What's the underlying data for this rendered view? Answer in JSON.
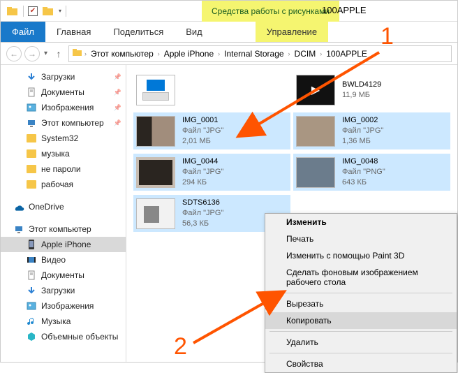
{
  "annotations": {
    "num1": "1",
    "num2": "2"
  },
  "titlebar": {
    "context_tab": "Средства работы с рисунками",
    "title": "100APPLE"
  },
  "ribbon": {
    "file": "Файл",
    "tabs": [
      "Главная",
      "Поделиться",
      "Вид"
    ],
    "context": "Управление"
  },
  "address": {
    "crumbs": [
      "Этот компьютер",
      "Apple iPhone",
      "Internal Storage",
      "DCIM",
      "100APPLE"
    ]
  },
  "sidebar": {
    "quick": [
      {
        "label": "Загрузки",
        "icon": "down-arrow",
        "pinned": true
      },
      {
        "label": "Документы",
        "icon": "doc",
        "pinned": true
      },
      {
        "label": "Изображения",
        "icon": "pic",
        "pinned": true
      },
      {
        "label": "Этот компьютер",
        "icon": "pc",
        "pinned": true
      },
      {
        "label": "System32",
        "icon": "folder"
      },
      {
        "label": "музыка",
        "icon": "folder"
      },
      {
        "label": "не пароли",
        "icon": "folder"
      },
      {
        "label": "рабочая",
        "icon": "folder"
      }
    ],
    "onedrive": "OneDrive",
    "thispc": "Этот компьютер",
    "devices": [
      {
        "label": "Apple iPhone",
        "selected": true,
        "icon": "phone"
      },
      {
        "label": "Видео",
        "icon": "video"
      },
      {
        "label": "Документы",
        "icon": "doc"
      },
      {
        "label": "Загрузки",
        "icon": "down-arrow"
      },
      {
        "label": "Изображения",
        "icon": "pic"
      },
      {
        "label": "Музыка",
        "icon": "music"
      },
      {
        "label": "Объемные объекты",
        "icon": "3d"
      }
    ]
  },
  "files": [
    {
      "name": "",
      "sub1": "",
      "sub2": "",
      "thumb": "drive",
      "sel": false
    },
    {
      "name": "BWLD4129",
      "sub1": "11,9 МБ",
      "sub2": "",
      "thumb": "video",
      "sel": false
    },
    {
      "name": "IMG_0001",
      "sub1": "Файл \"JPG\"",
      "sub2": "2,01 МБ",
      "thumb": "img1",
      "sel": true
    },
    {
      "name": "IMG_0002",
      "sub1": "Файл \"JPG\"",
      "sub2": "1,36 МБ",
      "thumb": "img2",
      "sel": true
    },
    {
      "name": "IMG_0044",
      "sub1": "Файл \"JPG\"",
      "sub2": "294 КБ",
      "thumb": "img3",
      "sel": true
    },
    {
      "name": "IMG_0048",
      "sub1": "Файл \"PNG\"",
      "sub2": "643 КБ",
      "thumb": "img4",
      "sel": true
    },
    {
      "name": "SDTS6136",
      "sub1": "Файл \"JPG\"",
      "sub2": "56,3 КБ",
      "thumb": "img5",
      "sel": true
    }
  ],
  "context_menu": [
    {
      "label": "Изменить",
      "type": "item",
      "bold": true
    },
    {
      "label": "Печать",
      "type": "item"
    },
    {
      "label": "Изменить с помощью Paint 3D",
      "type": "item"
    },
    {
      "label": "Сделать фоновым изображением рабочего стола",
      "type": "item"
    },
    {
      "type": "sep"
    },
    {
      "label": "Вырезать",
      "type": "item"
    },
    {
      "label": "Копировать",
      "type": "item",
      "hover": true
    },
    {
      "type": "sep"
    },
    {
      "label": "Удалить",
      "type": "item"
    },
    {
      "type": "sep"
    },
    {
      "label": "Свойства",
      "type": "item"
    }
  ]
}
